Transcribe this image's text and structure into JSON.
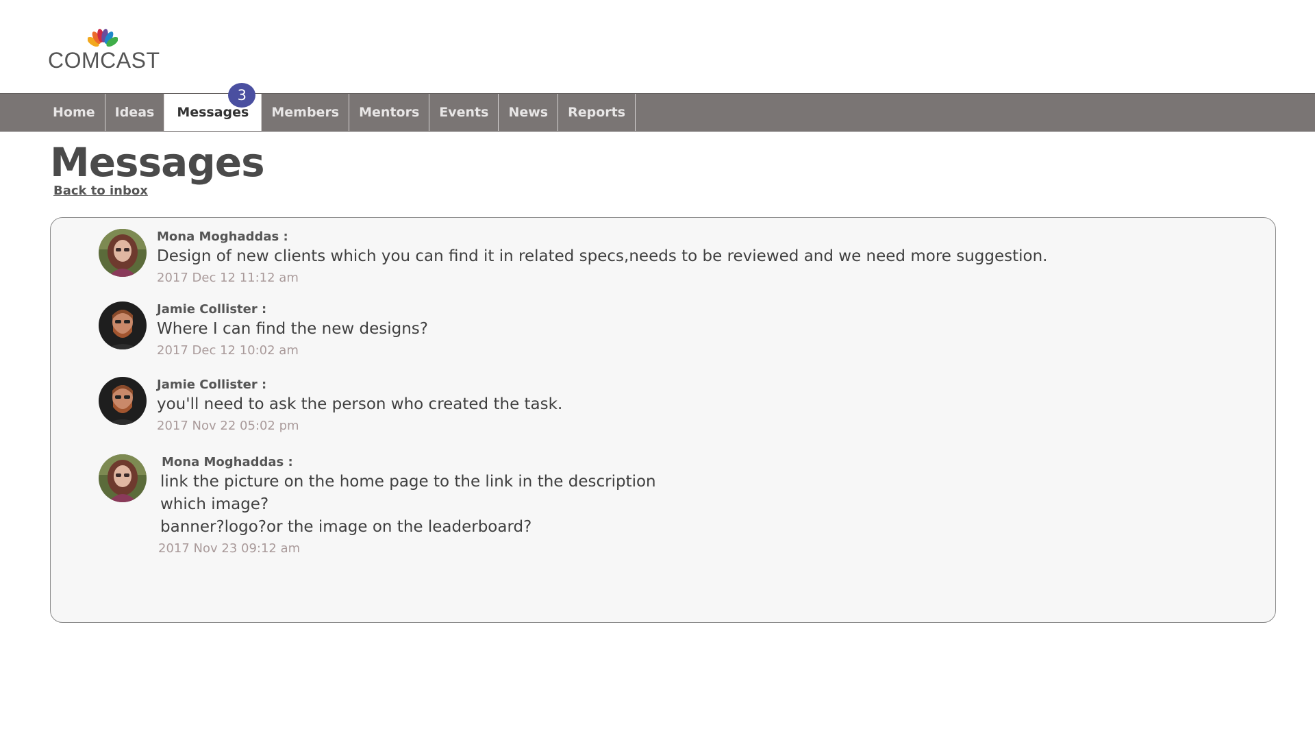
{
  "brand": {
    "logo_text": "COMCAST",
    "peacock_colors": [
      "#f2a81d",
      "#ec6a2b",
      "#cd2a45",
      "#6a4d9b",
      "#1e88c9",
      "#3fae49"
    ]
  },
  "nav": {
    "items": [
      {
        "label": "Home"
      },
      {
        "label": "Ideas"
      },
      {
        "label": "Messages",
        "badge": "3",
        "active": true
      },
      {
        "label": "Members"
      },
      {
        "label": "Mentors"
      },
      {
        "label": "Events"
      },
      {
        "label": "News"
      },
      {
        "label": "Reports"
      }
    ],
    "background_color": "#7a7574",
    "badge_color": "#4a4fa0"
  },
  "page": {
    "title": "Messages",
    "back_link": "Back to inbox"
  },
  "messages": [
    {
      "sender": "Mona Moghaddas :",
      "avatar": "avatar-mona",
      "lines": [
        "Design of new clients which you can find it in related specs,needs to be reviewed and we need more suggestion."
      ],
      "timestamp": "2017 Dec 12  11:12 am"
    },
    {
      "sender": "Jamie Collister :",
      "avatar": "avatar-jamie",
      "lines": [
        "Where I can find the new designs?"
      ],
      "timestamp": "2017 Dec 12  10:02 am"
    },
    {
      "sender": "Jamie Collister :",
      "avatar": "avatar-jamie",
      "lines": [
        "you'll need to ask the person who created the task."
      ],
      "timestamp": "2017 Nov 22  05:02 pm"
    },
    {
      "sender": "Mona Moghaddas :",
      "avatar": "avatar-mona",
      "lines": [
        "link the picture on the home page to the link in the description",
        "which image?",
        "banner?logo?or the image on the leaderboard?"
      ],
      "timestamp": "2017 Nov 23  09:12 am"
    }
  ]
}
